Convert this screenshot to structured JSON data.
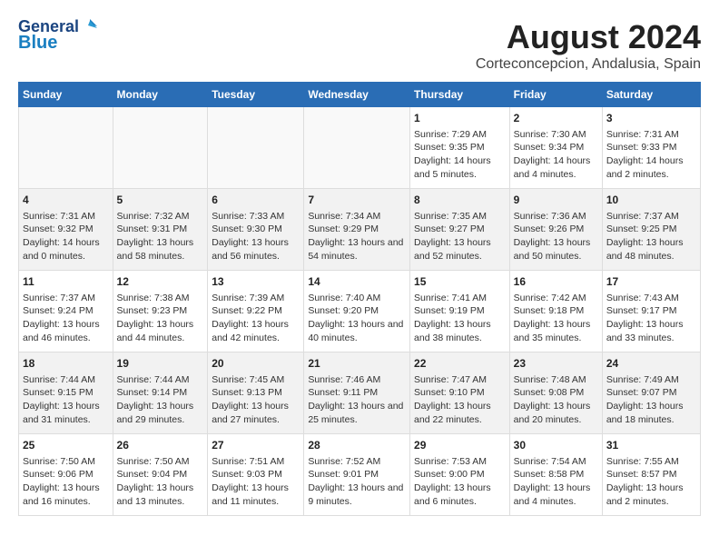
{
  "header": {
    "logo_general": "General",
    "logo_blue": "Blue",
    "title": "August 2024",
    "subtitle": "Corteconcepcion, Andalusia, Spain"
  },
  "days_of_week": [
    "Sunday",
    "Monday",
    "Tuesday",
    "Wednesday",
    "Thursday",
    "Friday",
    "Saturday"
  ],
  "weeks": [
    [
      {
        "day": "",
        "content": ""
      },
      {
        "day": "",
        "content": ""
      },
      {
        "day": "",
        "content": ""
      },
      {
        "day": "",
        "content": ""
      },
      {
        "day": "1",
        "content": "Sunrise: 7:29 AM\nSunset: 9:35 PM\nDaylight: 14 hours and 5 minutes."
      },
      {
        "day": "2",
        "content": "Sunrise: 7:30 AM\nSunset: 9:34 PM\nDaylight: 14 hours and 4 minutes."
      },
      {
        "day": "3",
        "content": "Sunrise: 7:31 AM\nSunset: 9:33 PM\nDaylight: 14 hours and 2 minutes."
      }
    ],
    [
      {
        "day": "4",
        "content": "Sunrise: 7:31 AM\nSunset: 9:32 PM\nDaylight: 14 hours and 0 minutes."
      },
      {
        "day": "5",
        "content": "Sunrise: 7:32 AM\nSunset: 9:31 PM\nDaylight: 13 hours and 58 minutes."
      },
      {
        "day": "6",
        "content": "Sunrise: 7:33 AM\nSunset: 9:30 PM\nDaylight: 13 hours and 56 minutes."
      },
      {
        "day": "7",
        "content": "Sunrise: 7:34 AM\nSunset: 9:29 PM\nDaylight: 13 hours and 54 minutes."
      },
      {
        "day": "8",
        "content": "Sunrise: 7:35 AM\nSunset: 9:27 PM\nDaylight: 13 hours and 52 minutes."
      },
      {
        "day": "9",
        "content": "Sunrise: 7:36 AM\nSunset: 9:26 PM\nDaylight: 13 hours and 50 minutes."
      },
      {
        "day": "10",
        "content": "Sunrise: 7:37 AM\nSunset: 9:25 PM\nDaylight: 13 hours and 48 minutes."
      }
    ],
    [
      {
        "day": "11",
        "content": "Sunrise: 7:37 AM\nSunset: 9:24 PM\nDaylight: 13 hours and 46 minutes."
      },
      {
        "day": "12",
        "content": "Sunrise: 7:38 AM\nSunset: 9:23 PM\nDaylight: 13 hours and 44 minutes."
      },
      {
        "day": "13",
        "content": "Sunrise: 7:39 AM\nSunset: 9:22 PM\nDaylight: 13 hours and 42 minutes."
      },
      {
        "day": "14",
        "content": "Sunrise: 7:40 AM\nSunset: 9:20 PM\nDaylight: 13 hours and 40 minutes."
      },
      {
        "day": "15",
        "content": "Sunrise: 7:41 AM\nSunset: 9:19 PM\nDaylight: 13 hours and 38 minutes."
      },
      {
        "day": "16",
        "content": "Sunrise: 7:42 AM\nSunset: 9:18 PM\nDaylight: 13 hours and 35 minutes."
      },
      {
        "day": "17",
        "content": "Sunrise: 7:43 AM\nSunset: 9:17 PM\nDaylight: 13 hours and 33 minutes."
      }
    ],
    [
      {
        "day": "18",
        "content": "Sunrise: 7:44 AM\nSunset: 9:15 PM\nDaylight: 13 hours and 31 minutes."
      },
      {
        "day": "19",
        "content": "Sunrise: 7:44 AM\nSunset: 9:14 PM\nDaylight: 13 hours and 29 minutes."
      },
      {
        "day": "20",
        "content": "Sunrise: 7:45 AM\nSunset: 9:13 PM\nDaylight: 13 hours and 27 minutes."
      },
      {
        "day": "21",
        "content": "Sunrise: 7:46 AM\nSunset: 9:11 PM\nDaylight: 13 hours and 25 minutes."
      },
      {
        "day": "22",
        "content": "Sunrise: 7:47 AM\nSunset: 9:10 PM\nDaylight: 13 hours and 22 minutes."
      },
      {
        "day": "23",
        "content": "Sunrise: 7:48 AM\nSunset: 9:08 PM\nDaylight: 13 hours and 20 minutes."
      },
      {
        "day": "24",
        "content": "Sunrise: 7:49 AM\nSunset: 9:07 PM\nDaylight: 13 hours and 18 minutes."
      }
    ],
    [
      {
        "day": "25",
        "content": "Sunrise: 7:50 AM\nSunset: 9:06 PM\nDaylight: 13 hours and 16 minutes."
      },
      {
        "day": "26",
        "content": "Sunrise: 7:50 AM\nSunset: 9:04 PM\nDaylight: 13 hours and 13 minutes."
      },
      {
        "day": "27",
        "content": "Sunrise: 7:51 AM\nSunset: 9:03 PM\nDaylight: 13 hours and 11 minutes."
      },
      {
        "day": "28",
        "content": "Sunrise: 7:52 AM\nSunset: 9:01 PM\nDaylight: 13 hours and 9 minutes."
      },
      {
        "day": "29",
        "content": "Sunrise: 7:53 AM\nSunset: 9:00 PM\nDaylight: 13 hours and 6 minutes."
      },
      {
        "day": "30",
        "content": "Sunrise: 7:54 AM\nSunset: 8:58 PM\nDaylight: 13 hours and 4 minutes."
      },
      {
        "day": "31",
        "content": "Sunrise: 7:55 AM\nSunset: 8:57 PM\nDaylight: 13 hours and 2 minutes."
      }
    ]
  ]
}
